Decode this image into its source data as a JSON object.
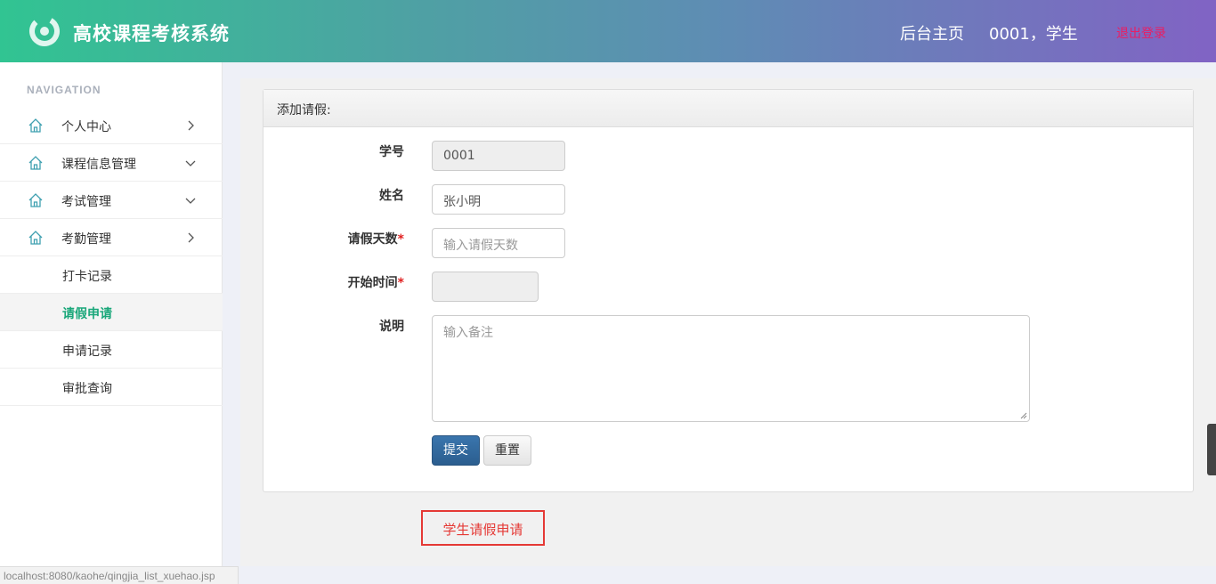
{
  "header": {
    "title": "高校课程考核系统",
    "home_link": "后台主页",
    "user": "0001，学生",
    "logout": "退出登录"
  },
  "sidebar": {
    "heading": "NAVIGATION",
    "menu": [
      {
        "label": "个人中心",
        "icon": "home-icon",
        "chevron": "right"
      },
      {
        "label": "课程信息管理",
        "icon": "home-icon",
        "chevron": "down"
      },
      {
        "label": "考试管理",
        "icon": "home-icon",
        "chevron": "down"
      },
      {
        "label": "考勤管理",
        "icon": "home-icon",
        "chevron": "right"
      }
    ],
    "submenu": [
      {
        "label": "打卡记录"
      },
      {
        "label": "请假申请",
        "active": true
      },
      {
        "label": "申请记录"
      },
      {
        "label": "审批查询"
      }
    ]
  },
  "form": {
    "panel_title": "添加请假:",
    "student_id_label": "学号",
    "student_id_value": "0001",
    "name_label": "姓名",
    "name_value": "张小明",
    "days_label": "请假天数",
    "days_placeholder": "输入请假天数",
    "start_label": "开始时间",
    "start_value": "",
    "remark_label": "说明",
    "remark_placeholder": "输入备注",
    "required_mark": "*",
    "submit": "提交",
    "reset": "重置"
  },
  "annotation": "学生请假申请",
  "status_bar": "localhost:8080/kaohe/qingjia_list_xuehao.jsp",
  "colors": {
    "accent_green": "#1aa77a",
    "logout": "#e91e63",
    "primary_button": "#2b5e8f",
    "annotation_red": "#e53935"
  }
}
